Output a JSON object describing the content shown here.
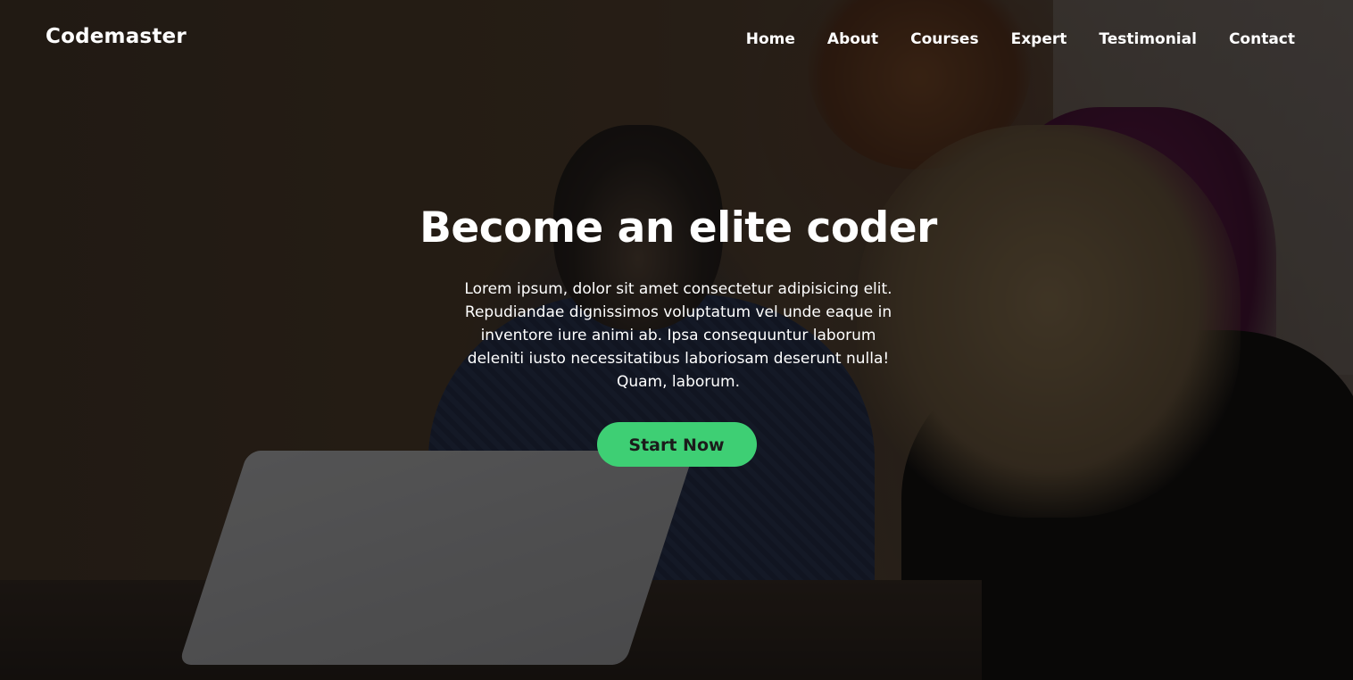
{
  "brand": {
    "name": "Codemaster"
  },
  "nav": {
    "items": [
      {
        "label": "Home"
      },
      {
        "label": "About"
      },
      {
        "label": "Courses"
      },
      {
        "label": "Expert"
      },
      {
        "label": "Testimonial"
      },
      {
        "label": "Contact"
      }
    ]
  },
  "hero": {
    "title": "Become an elite coder",
    "description": "Lorem ipsum, dolor sit amet consectetur adipisicing elit. Repudiandae dignissimos voluptatum vel unde eaque in inventore iure animi ab. Ipsa consequuntur laborum deleniti iusto necessitatibus laboriosam deserunt nulla! Quam, laborum.",
    "cta_label": "Start Now"
  },
  "colors": {
    "cta_background": "#3ecf74",
    "text": "#ffffff",
    "overlay": "#000000"
  }
}
